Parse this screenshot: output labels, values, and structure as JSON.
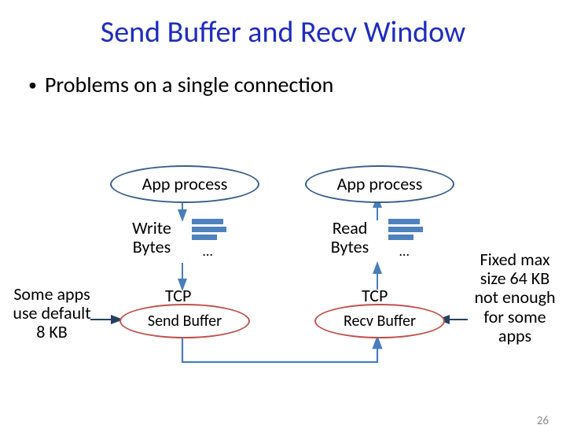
{
  "title": "Send Buffer and Recv Window",
  "bullet": "Problems on a single connection",
  "diagram": {
    "left": {
      "app_process": "App process",
      "action_label": "Write\nBytes",
      "ellipsis": "…",
      "tcp_label": "TCP",
      "buffer_label": "Send Buffer"
    },
    "right": {
      "app_process": "App process",
      "action_label": "Read\nBytes",
      "ellipsis": "…",
      "tcp_label": "TCP",
      "buffer_label": "Recv Buffer"
    }
  },
  "notes": {
    "left": "Some apps use default 8 KB",
    "right": "Fixed max size 64 KB not enough for some apps"
  },
  "slide_number": "26"
}
